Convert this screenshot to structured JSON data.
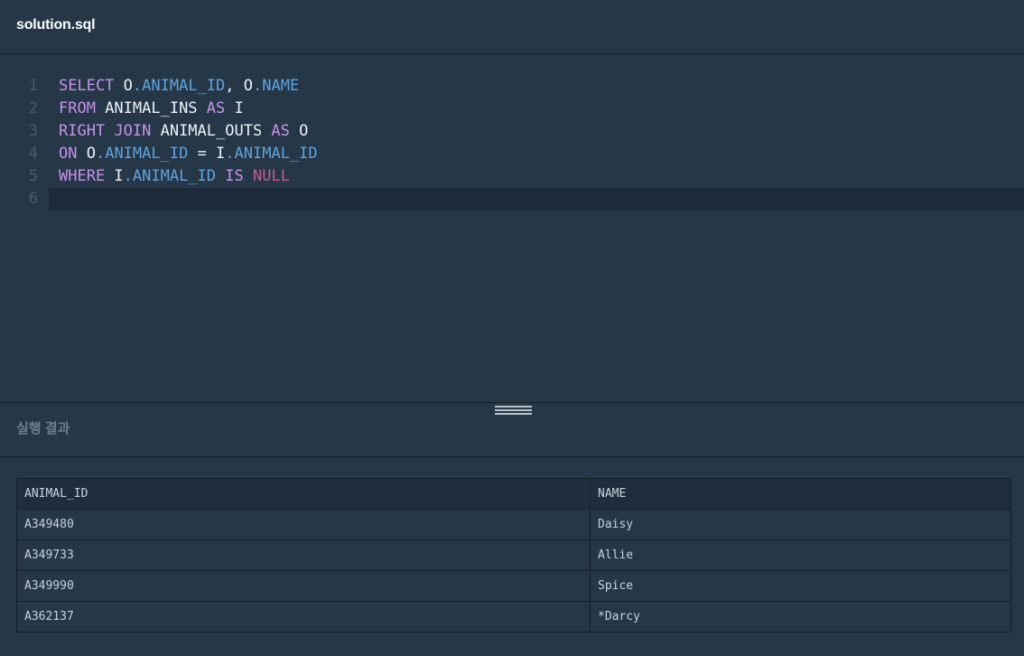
{
  "file": {
    "title": "solution.sql"
  },
  "editor": {
    "line_numbers": [
      "1",
      "2",
      "3",
      "4",
      "5",
      "6"
    ],
    "lines": [
      [
        {
          "t": "SELECT",
          "c": "kw"
        },
        {
          "t": " ",
          "c": "plain"
        },
        {
          "t": "O",
          "c": "plain"
        },
        {
          "t": ".ANIMAL_ID",
          "c": "prop"
        },
        {
          "t": ", ",
          "c": "plain"
        },
        {
          "t": "O",
          "c": "plain"
        },
        {
          "t": ".NAME",
          "c": "prop"
        }
      ],
      [
        {
          "t": "FROM",
          "c": "kw"
        },
        {
          "t": " ANIMAL_INS ",
          "c": "plain"
        },
        {
          "t": "AS",
          "c": "kw"
        },
        {
          "t": " I",
          "c": "plain"
        }
      ],
      [
        {
          "t": "RIGHT JOIN",
          "c": "kw"
        },
        {
          "t": " ANIMAL_OUTS ",
          "c": "plain"
        },
        {
          "t": "AS",
          "c": "kw"
        },
        {
          "t": " O",
          "c": "plain"
        }
      ],
      [
        {
          "t": "ON",
          "c": "kw"
        },
        {
          "t": " O",
          "c": "plain"
        },
        {
          "t": ".ANIMAL_ID",
          "c": "prop"
        },
        {
          "t": " = I",
          "c": "plain"
        },
        {
          "t": ".ANIMAL_ID",
          "c": "prop"
        }
      ],
      [
        {
          "t": "WHERE",
          "c": "kw"
        },
        {
          "t": " I",
          "c": "plain"
        },
        {
          "t": ".ANIMAL_ID",
          "c": "prop"
        },
        {
          "t": " ",
          "c": "plain"
        },
        {
          "t": "IS",
          "c": "kw"
        },
        {
          "t": " ",
          "c": "plain"
        },
        {
          "t": "NULL",
          "c": "null"
        }
      ],
      []
    ],
    "active_line": 6
  },
  "results": {
    "title": "실행 결과",
    "columns": [
      "ANIMAL_ID",
      "NAME"
    ],
    "rows": [
      [
        "A349480",
        "Daisy"
      ],
      [
        "A349733",
        "Allie"
      ],
      [
        "A349990",
        "Spice"
      ],
      [
        "A362137",
        "*Darcy"
      ]
    ]
  },
  "colors": {
    "background": "#263747",
    "keyword": "#c792ea",
    "property": "#5fa4e0",
    "null": "#c2608e"
  }
}
